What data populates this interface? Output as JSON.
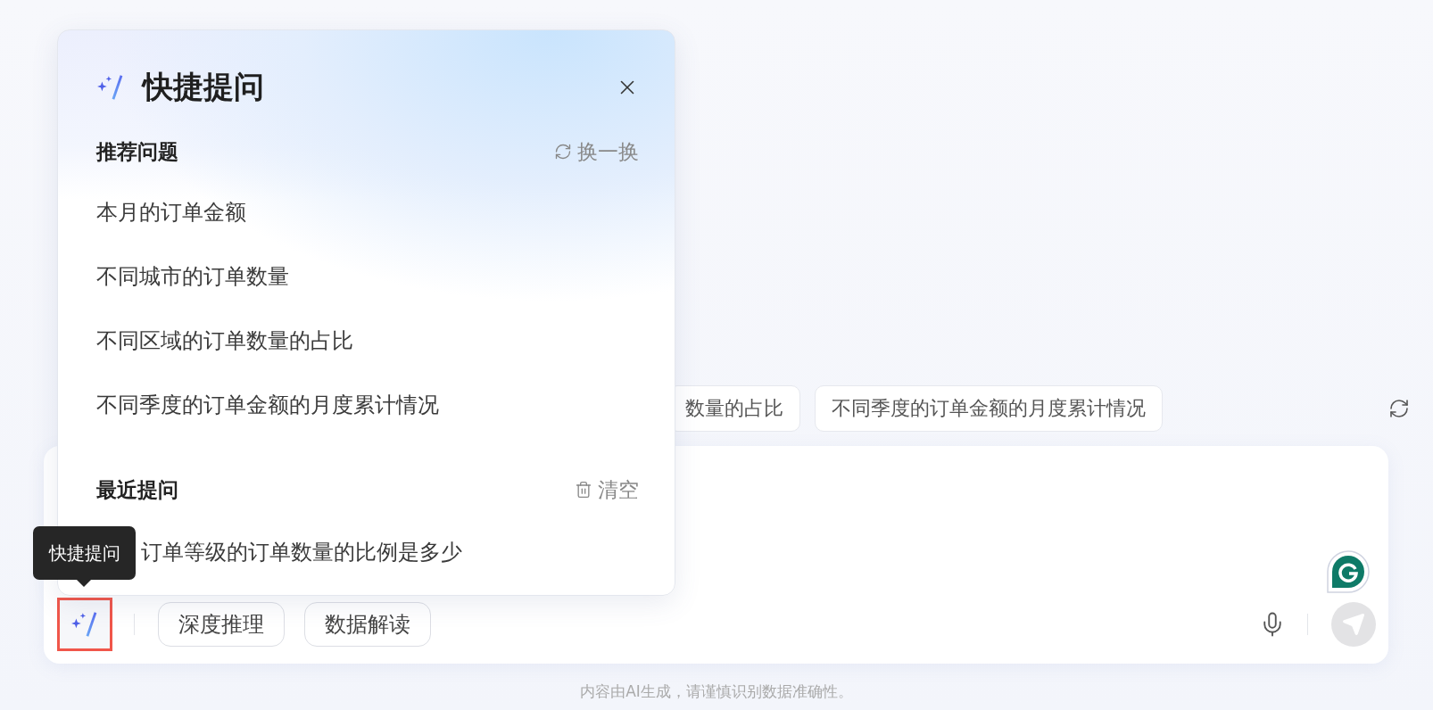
{
  "background": {
    "suggestion_chips": [
      {
        "label": "数量的占比"
      },
      {
        "label": "不同季度的订单金额的月度累计情况"
      }
    ]
  },
  "input": {
    "mode_buttons": [
      {
        "label": "深度推理"
      },
      {
        "label": "数据解读"
      }
    ]
  },
  "tooltip": "快捷提问",
  "popup": {
    "title": "快捷提问",
    "recommended": {
      "heading": "推荐问题",
      "action": "换一换",
      "items": [
        {
          "text": "本月的订单金额"
        },
        {
          "text": "不同城市的订单数量"
        },
        {
          "text": "不同区域的订单数量的占比"
        },
        {
          "text": "不同季度的订单金额的月度累计情况"
        }
      ]
    },
    "recent": {
      "heading": "最近提问",
      "action": "清空",
      "items": [
        {
          "text": "订单等级的订单数量的比例是多少"
        }
      ]
    }
  },
  "footer": "内容由AI生成，请谨慎识别数据准确性。"
}
